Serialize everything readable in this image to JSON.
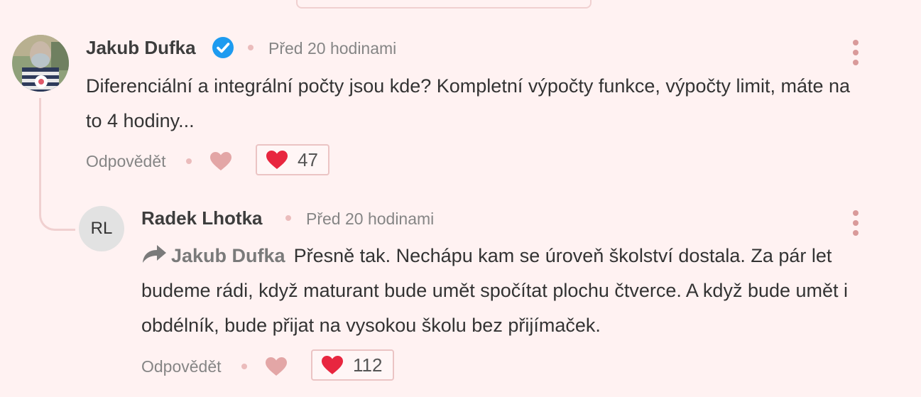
{
  "comments": [
    {
      "author": "Jakub Dufka",
      "verified": true,
      "time": "Před 20 hodinami",
      "text": "Diferenciální a integrální počty jsou kde? Kompletní výpočty funkce, výpočty limit, máte na to 4 hodiny...",
      "reply_label": "Odpovědět",
      "likes": "47"
    },
    {
      "author": "Radek Lhotka",
      "initials": "RL",
      "time": "Před 20 hodinami",
      "mention": "Jakub Dufka",
      "text": "Přesně tak. Nechápu kam se úroveň školství dostala. Za pár let budeme rádi, když maturant bude umět spočítat plochu čtverce. A když bude umět i obdélník, bude přijat na vysokou školu bez přijímaček.",
      "reply_label": "Odpovědět",
      "likes": "112"
    }
  ],
  "icons": {
    "verified": "verified-badge-icon",
    "heart_outline": "heart-outline-icon",
    "heart_filled": "heart-filled-icon",
    "more": "more-vertical-icon",
    "reply_arrow": "reply-arrow-icon"
  },
  "colors": {
    "background": "#fff2f2",
    "accent_heart": "#e8263f",
    "verified": "#1d9bf0",
    "muted_heart": "#e3a6a6"
  }
}
